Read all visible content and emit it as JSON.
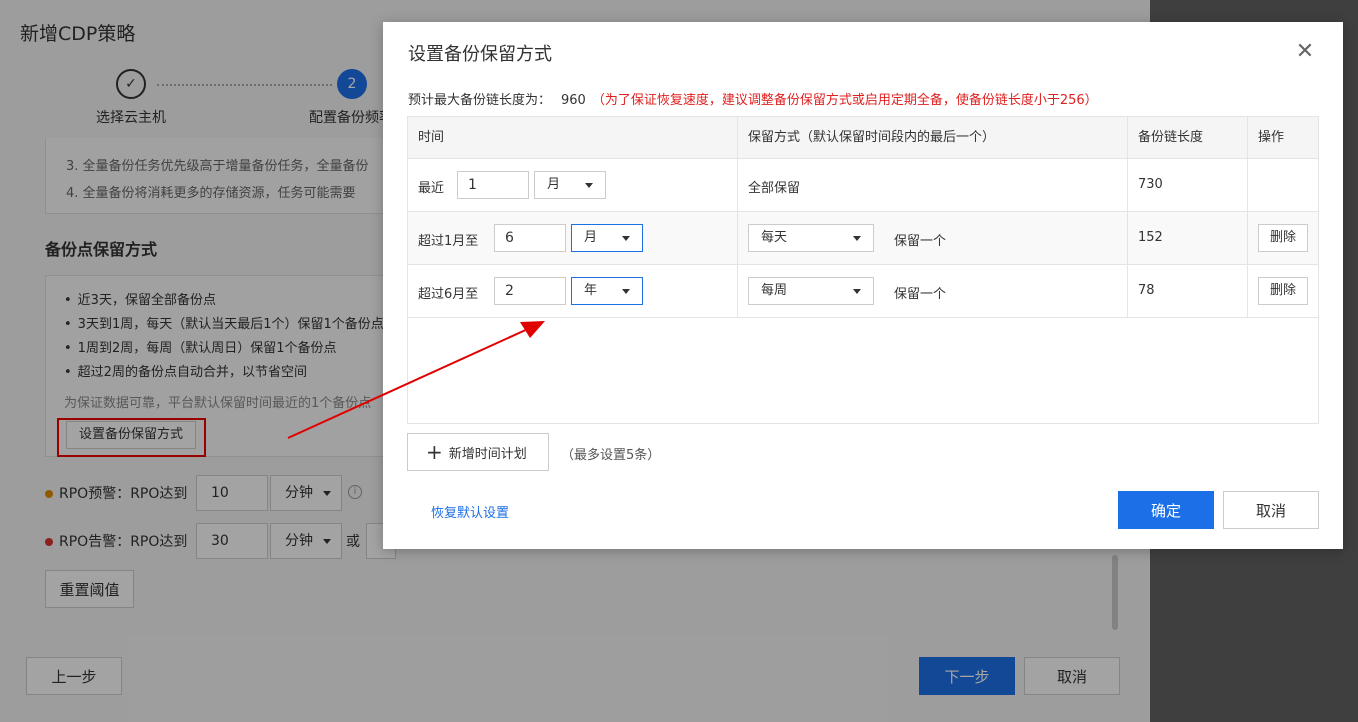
{
  "background": {
    "title": "新增CDP策略",
    "steps": [
      {
        "label": "选择云主机",
        "state": "done"
      },
      {
        "label": "配置备份频率",
        "number": "2",
        "state": "active"
      }
    ],
    "notes": [
      "3. 全量备份任务优先级高于增量备份任务，全量备份",
      "4. 全量备份将消耗更多的存储资源，任务可能需要"
    ],
    "section_title": "备份点保留方式",
    "rules": [
      "近3天，保留全部备份点",
      "3天到1周，每天（默认当天最后1个）保留1个备份点",
      "1周到2周，每周（默认周日）保留1个备份点",
      "超过2周的备份点自动合并，以节省空间"
    ],
    "rules_hint": "为保证数据可靠，平台默认保留时间最近的1个备份点",
    "set_button": "设置备份保留方式",
    "rpo_warn": {
      "label": "RPO预警：RPO达到",
      "value": "10",
      "unit": "分钟",
      "color": "#e08a00"
    },
    "rpo_alert": {
      "label": "RPO告警：RPO达到",
      "value": "30",
      "unit": "分钟",
      "or": "或",
      "color": "#d93030"
    },
    "reset_button": "重置阈值",
    "prev_button": "上一步",
    "next_button": "下一步",
    "cancel_button": "取消"
  },
  "modal": {
    "title": "设置备份保留方式",
    "chain_label": "预计最大备份链长度为：",
    "chain_value": "960",
    "chain_warning": "（为了保证恢复速度，建议调整备份保留方式或启用定期全备，使备份链长度小于256）",
    "table": {
      "headers": [
        "时间",
        "保留方式（默认保留时间段内的最后一个）",
        "备份链长度",
        "操作"
      ],
      "rows": [
        {
          "prefix": "最近",
          "value": "1",
          "unit": "月",
          "retention": "全部保留",
          "chain": "730"
        },
        {
          "prefix": "超过1月至",
          "value": "6",
          "unit": "月",
          "freq": "每天",
          "keep": "保留一个",
          "chain": "152",
          "action": "删除"
        },
        {
          "prefix": "超过6月至",
          "value": "2",
          "unit": "年",
          "freq": "每周",
          "keep": "保留一个",
          "chain": "78",
          "action": "删除"
        }
      ]
    },
    "add_button": "新增时间计划",
    "add_hint": "（最多设置5条）",
    "restore_link": "恢复默认设置",
    "ok_button": "确定",
    "cancel_button": "取消"
  },
  "colors": {
    "primary": "#1c6fe6",
    "warning": "#e02020",
    "annotation": "#e00000"
  }
}
